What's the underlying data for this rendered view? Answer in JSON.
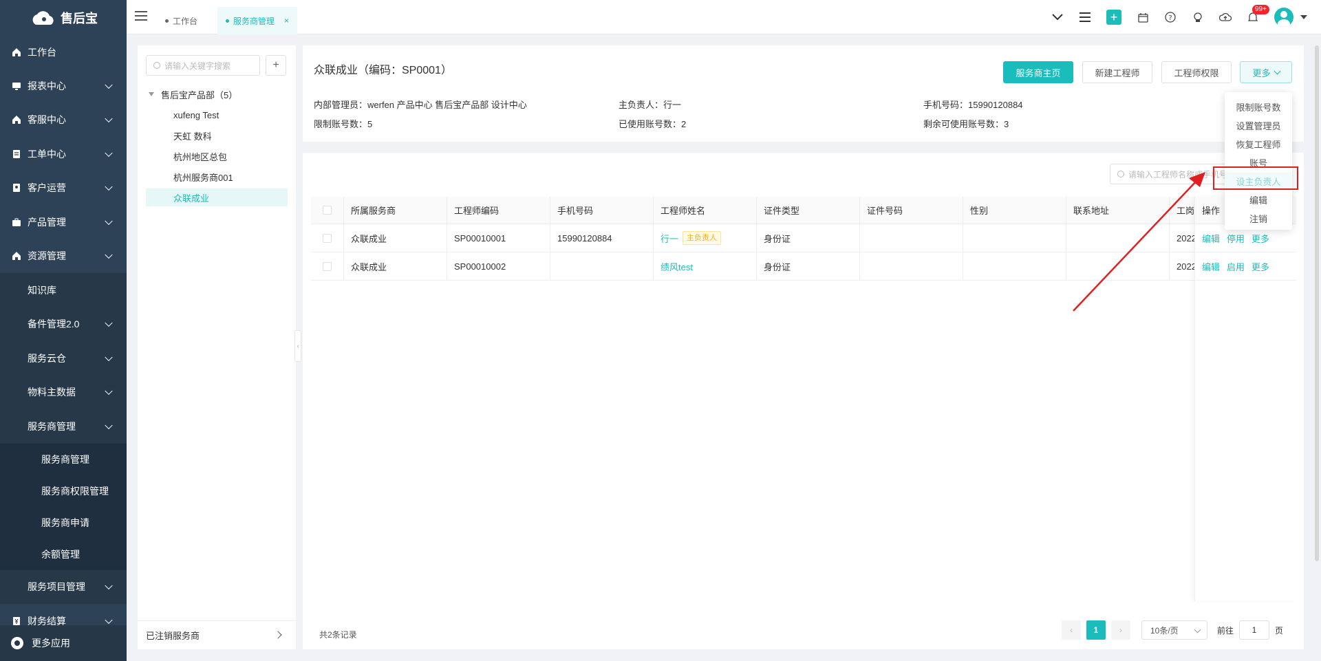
{
  "app": {
    "logo_text": "售后宝"
  },
  "sidebar": {
    "items": [
      {
        "label": "工作台",
        "icon": "home-icon",
        "has_children": false
      },
      {
        "label": "报表中心",
        "icon": "monitor-icon",
        "has_children": true
      },
      {
        "label": "客服中心",
        "icon": "home-icon",
        "has_children": true
      },
      {
        "label": "工单中心",
        "icon": "ticket-icon",
        "has_children": true
      },
      {
        "label": "客户运营",
        "icon": "user-card-icon",
        "has_children": true
      },
      {
        "label": "产品管理",
        "icon": "briefcase-icon",
        "has_children": true
      },
      {
        "label": "资源管理",
        "icon": "home-icon",
        "has_children": true
      },
      {
        "label": "知识库",
        "level": 2
      },
      {
        "label": "备件管理2.0",
        "level": 2,
        "has_children": true
      },
      {
        "label": "服务云仓",
        "level": 2,
        "has_children": true
      },
      {
        "label": "物料主数据",
        "level": 2,
        "has_children": true
      },
      {
        "label": "服务商管理",
        "level": 2,
        "has_children": true
      },
      {
        "label": "服务商管理",
        "level": 3
      },
      {
        "label": "服务商权限管理",
        "level": 3
      },
      {
        "label": "服务商申请",
        "level": 3
      },
      {
        "label": "余额管理",
        "level": 3
      },
      {
        "label": "服务项目管理",
        "level": 2,
        "has_children": true
      },
      {
        "label": "财务结算",
        "icon": "finance-icon",
        "has_children": true
      }
    ],
    "footer_label": "更多应用"
  },
  "tabs": [
    {
      "label": "工作台",
      "active": false
    },
    {
      "label": "服务商管理",
      "active": true,
      "close": "×"
    }
  ],
  "topbar": {
    "notification_badge": "99+"
  },
  "tree": {
    "search_placeholder": "请输入关键字搜索",
    "add_label": "+",
    "root": "售后宝产品部（5）",
    "children": [
      "xufeng Test",
      "天虹 数科",
      "杭州地区总包",
      "杭州服务商001",
      "众联成业"
    ],
    "selected": "众联成业",
    "footer_label": "已注销服务商"
  },
  "info": {
    "title": "众联成业（编码：SP0001）",
    "buttons": {
      "home": "服务商主页",
      "new_engineer": "新建工程师",
      "permission": "工程师权限",
      "more": "更多"
    },
    "fields": {
      "admin": "内部管理员：werfen 产品中心 售后宝产品部 设计中心",
      "leader": "主负责人：行一",
      "phone": "手机号码：15990120884",
      "limit": "限制账号数：5",
      "used": "已使用账号数：2",
      "remaining": "剩余可使用账号数：3"
    }
  },
  "table": {
    "search_placeholder": "请输入工程师名称或手机号",
    "columns": [
      "所属服务商",
      "工程师编码",
      "手机号码",
      "工程师姓名",
      "证件类型",
      "证件号码",
      "性别",
      "联系地址",
      "工岗",
      "操作"
    ],
    "rows": [
      {
        "provider": "众联成业",
        "code": "SP00010001",
        "phone": "15990120884",
        "name": "行一",
        "tag": "主负责人",
        "id_type": "身份证",
        "id_no": "",
        "gender": "",
        "address": "",
        "post": "2022",
        "ops": [
          "编辑",
          "停用",
          "更多"
        ]
      },
      {
        "provider": "众联成业",
        "code": "SP00010002",
        "phone": "",
        "name": "绩风test",
        "tag": "",
        "id_type": "身份证",
        "id_no": "",
        "gender": "",
        "address": "",
        "post": "2022",
        "ops": [
          "编辑",
          "启用",
          "更多"
        ]
      }
    ],
    "total_text": "共2条记录"
  },
  "pagination": {
    "current": "1",
    "page_size": "10条/页",
    "goto_label": "前往",
    "goto_value": "1",
    "page_suffix": "页"
  },
  "more_menu": {
    "items": [
      "限制账号数",
      "设置管理员",
      "恢复工程师",
      "账号",
      "设主负责人",
      "编辑",
      "注销"
    ],
    "highlighted": "设主负责人"
  },
  "colors": {
    "accent": "#1bbcbc",
    "sidebar": "#2e4257",
    "annotation_red": "#e02020"
  }
}
